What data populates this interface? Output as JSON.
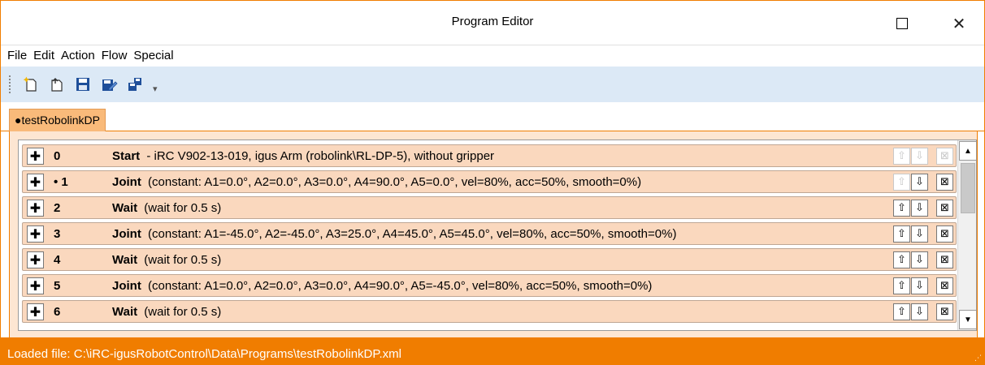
{
  "window": {
    "title": "Program Editor",
    "maximize_icon": "maximize-icon",
    "close_icon": "close-icon",
    "close_glyph": "✕"
  },
  "menu": [
    "File",
    "Edit",
    "Action",
    "Flow",
    "Special"
  ],
  "toolbar": {
    "buttons": [
      "new-program-icon",
      "open-program-icon",
      "save-icon",
      "save-as-icon",
      "save-to-robot-icon"
    ],
    "overflow_glyph": "▾"
  },
  "tab": {
    "label": "●testRobolinkDP"
  },
  "program": {
    "rows": [
      {
        "num": "0",
        "command": "Start",
        "params": "- iRC V902-13-019, igus Arm (robolink\\RL-DP-5), without gripper",
        "up_enabled": false,
        "down_enabled": false,
        "delete_enabled": false
      },
      {
        "num": "• 1",
        "command": "Joint",
        "params": "(constant: A1=0.0°, A2=0.0°, A3=0.0°, A4=90.0°, A5=0.0°, vel=80%, acc=50%, smooth=0%)",
        "up_enabled": false,
        "down_enabled": true,
        "delete_enabled": true
      },
      {
        "num": "2",
        "command": "Wait",
        "params": "(wait for 0.5 s)",
        "up_enabled": true,
        "down_enabled": true,
        "delete_enabled": true
      },
      {
        "num": "3",
        "command": "Joint",
        "params": "(constant: A1=-45.0°, A2=-45.0°, A3=25.0°, A4=45.0°, A5=45.0°, vel=80%, acc=50%, smooth=0%)",
        "up_enabled": true,
        "down_enabled": true,
        "delete_enabled": true
      },
      {
        "num": "4",
        "command": "Wait",
        "params": "(wait for 0.5 s)",
        "up_enabled": true,
        "down_enabled": true,
        "delete_enabled": true
      },
      {
        "num": "5",
        "command": "Joint",
        "params": "(constant: A1=0.0°, A2=0.0°, A3=0.0°, A4=90.0°, A5=-45.0°, vel=80%, acc=50%, smooth=0%)",
        "up_enabled": true,
        "down_enabled": true,
        "delete_enabled": true
      },
      {
        "num": "6",
        "command": "Wait",
        "params": "(wait for 0.5 s)",
        "up_enabled": true,
        "down_enabled": true,
        "delete_enabled": true
      }
    ],
    "glyphs": {
      "add": "✚",
      "up": "⇧",
      "down": "⇩",
      "delete": "⊠"
    }
  },
  "scrollbar": {
    "up_glyph": "▲",
    "down_glyph": "▼"
  },
  "status": {
    "text": "Loaded file: C:\\iRC-igusRobotControl\\Data\\Programs\\testRobolinkDP.xml"
  },
  "colors": {
    "accent": "#f07d00",
    "row_bg": "#fad8be",
    "tab_bg": "#f9ba7a",
    "toolbar_bg": "#dce9f6"
  }
}
